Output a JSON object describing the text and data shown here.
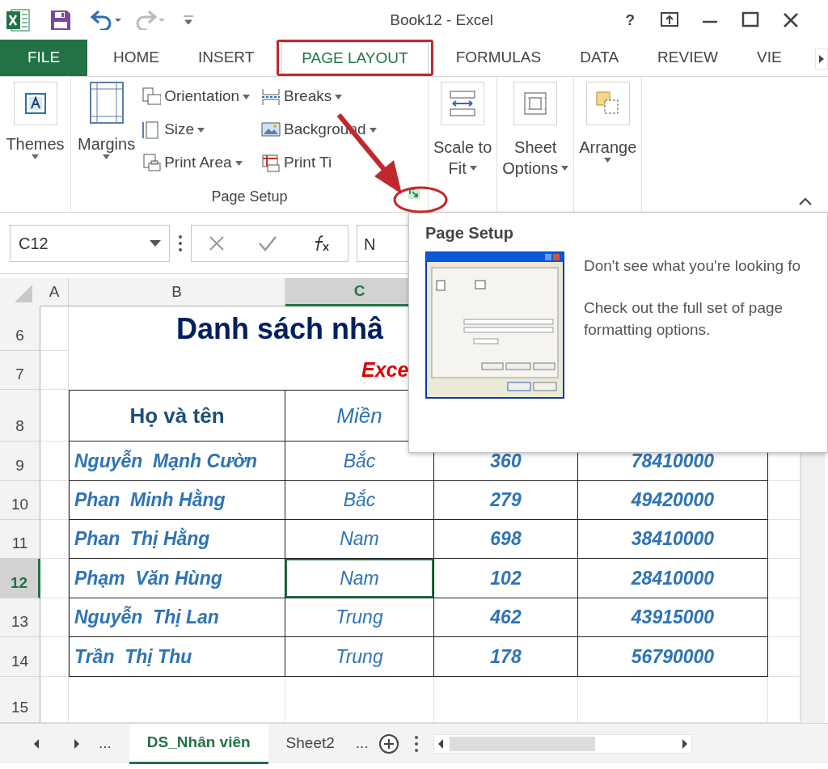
{
  "window": {
    "title": "Book12 - Excel",
    "help": "?"
  },
  "ribbon_tabs": [
    {
      "label": "FILE",
      "kind": "file",
      "selected": false
    },
    {
      "label": "HOME",
      "kind": "tab",
      "selected": false
    },
    {
      "label": "INSERT",
      "kind": "tab",
      "selected": false
    },
    {
      "label": "PAGE LAYOUT",
      "kind": "tab",
      "selected": true
    },
    {
      "label": "FORMULAS",
      "kind": "tab",
      "selected": false
    },
    {
      "label": "DATA",
      "kind": "tab",
      "selected": false
    },
    {
      "label": "REVIEW",
      "kind": "tab",
      "selected": false
    },
    {
      "label": "VIE",
      "kind": "tab",
      "selected": false
    }
  ],
  "ribbon": {
    "themes": {
      "label": "Themes"
    },
    "page_setup": {
      "label": "Page Setup",
      "margins": "Margins",
      "small_buttons": [
        {
          "label": "Orientation"
        },
        {
          "label": "Size"
        },
        {
          "label": "Print Area"
        },
        {
          "label": "Breaks"
        },
        {
          "label": "Background"
        },
        {
          "label": "Print Ti"
        }
      ]
    },
    "large_buttons": [
      {
        "label": "Scale to",
        "label2": "Fit"
      },
      {
        "label": "Sheet",
        "label2": "Options"
      },
      {
        "label": "Arrange"
      }
    ]
  },
  "formula_bar": {
    "name_box": "C12",
    "formula": "N"
  },
  "sheet": {
    "columns": [
      {
        "label": "A",
        "selected": false
      },
      {
        "label": "B",
        "selected": false
      },
      {
        "label": "C",
        "selected": true
      }
    ],
    "rows": [
      {
        "number": "6",
        "selected": false,
        "kind": "title",
        "text": "Danh sách nhâ"
      },
      {
        "number": "7",
        "selected": false,
        "kind": "subtitle",
        "text": "Exce"
      },
      {
        "number": "8",
        "selected": false,
        "kind": "header",
        "cells": [
          {
            "text": "Họ và tên"
          },
          {
            "text": "Miền"
          }
        ]
      },
      {
        "number": "9",
        "selected": false,
        "kind": "data",
        "cells": [
          {
            "text": "Nguyễn  Mạnh Cườn",
            "selected": false
          },
          {
            "text": "Bắc",
            "selected": false
          },
          {
            "text": "360",
            "selected": false
          },
          {
            "text": "78410000",
            "selected": false
          }
        ]
      },
      {
        "number": "10",
        "selected": false,
        "kind": "data",
        "cells": [
          {
            "text": "Phan  Minh Hằng",
            "selected": false
          },
          {
            "text": "Bắc",
            "selected": false
          },
          {
            "text": "279",
            "selected": false
          },
          {
            "text": "49420000",
            "selected": false
          }
        ]
      },
      {
        "number": "11",
        "selected": false,
        "kind": "data",
        "cells": [
          {
            "text": "Phan  Thị Hằng",
            "selected": false
          },
          {
            "text": "Nam",
            "selected": false
          },
          {
            "text": "698",
            "selected": false
          },
          {
            "text": "38410000",
            "selected": false
          }
        ]
      },
      {
        "number": "12",
        "selected": true,
        "kind": "data",
        "cells": [
          {
            "text": "Phạm  Văn Hùng",
            "selected": false
          },
          {
            "text": "Nam",
            "selected": true
          },
          {
            "text": "102",
            "selected": false
          },
          {
            "text": "28410000",
            "selected": false
          }
        ]
      },
      {
        "number": "13",
        "selected": false,
        "kind": "data",
        "cells": [
          {
            "text": "Nguyễn  Thị Lan",
            "selected": false
          },
          {
            "text": "Trung",
            "selected": false
          },
          {
            "text": "462",
            "selected": false
          },
          {
            "text": "43915000",
            "selected": false
          }
        ]
      },
      {
        "number": "14",
        "selected": false,
        "kind": "data",
        "cells": [
          {
            "text": "Trần  Thị Thu",
            "selected": false
          },
          {
            "text": "Trung",
            "selected": false
          },
          {
            "text": "178",
            "selected": false
          },
          {
            "text": "56790000",
            "selected": false
          }
        ]
      },
      {
        "number": "15",
        "selected": false,
        "kind": "empty"
      }
    ]
  },
  "sheet_tabs": {
    "more_left": "...",
    "tabs": [
      {
        "label": "DS_Nhân viên",
        "selected": true
      },
      {
        "label": "Sheet2",
        "selected": false
      }
    ],
    "more_right": "..."
  },
  "tooltip": {
    "title": "Page Setup",
    "lines": [
      "Don't see what you're looking fo",
      "Check out the full set of page formatting options."
    ]
  }
}
